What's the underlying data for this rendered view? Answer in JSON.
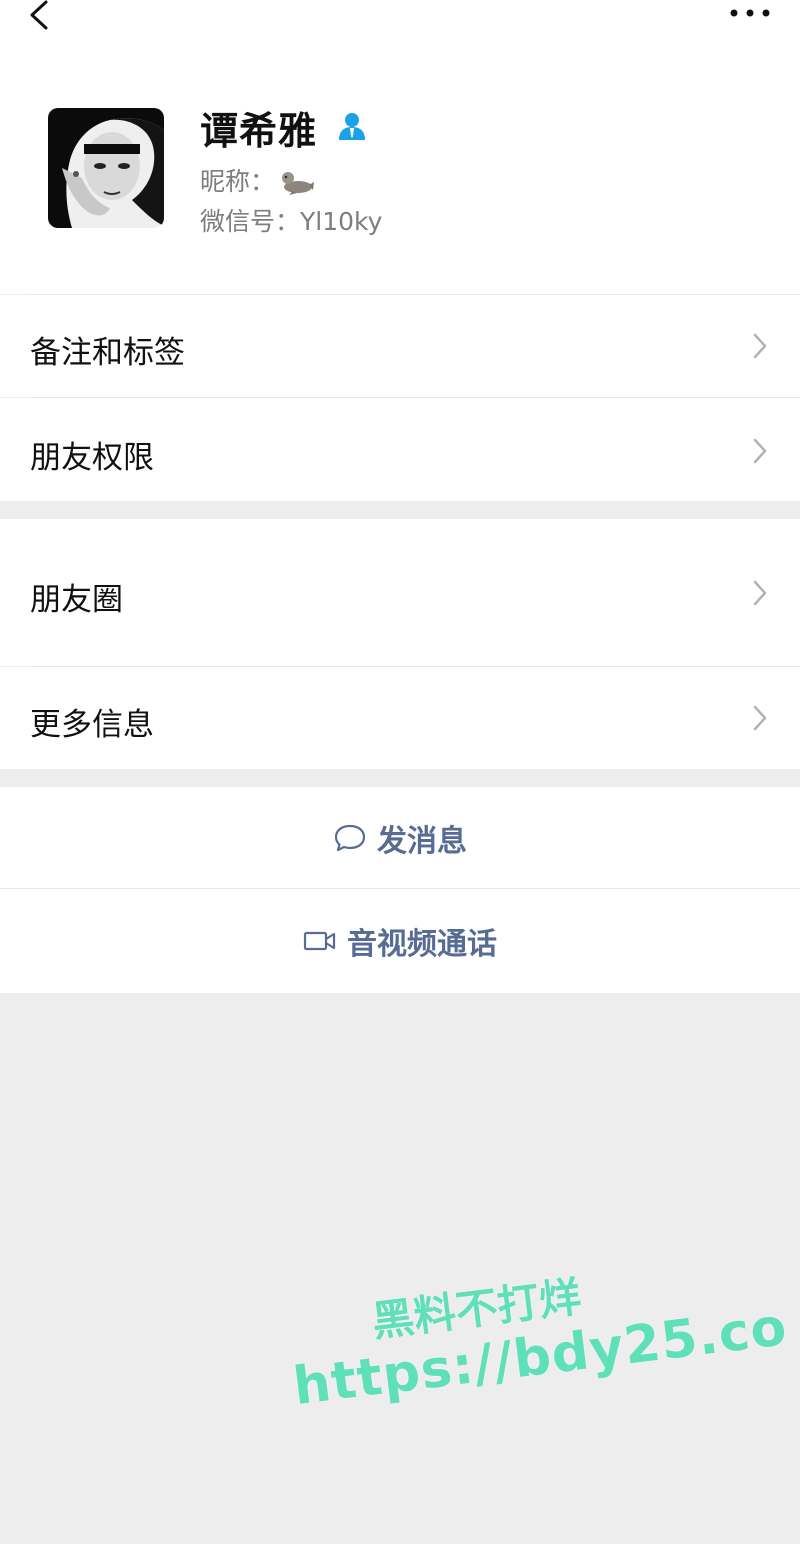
{
  "profile": {
    "name": "谭希雅",
    "nickname_label": "昵称：",
    "wechat_id_label": "微信号：",
    "wechat_id": "Yl10ky"
  },
  "menu": {
    "remark_tags": "备注和标签",
    "friend_permissions": "朋友权限",
    "moments": "朋友圈",
    "more_info": "更多信息"
  },
  "actions": {
    "send_message": "发消息",
    "video_call": "音视频通话"
  },
  "watermark": {
    "line1": "黑料不打烊",
    "line2": "https://bdy25.co"
  },
  "colors": {
    "link_blue": "#576b95",
    "badge_blue": "#1aa2e8",
    "watermark_green": "#5fe0b9",
    "page_bg": "#ededed"
  },
  "icons": [
    "back-icon",
    "more-icon",
    "person-badge-icon",
    "seal-emoji-icon",
    "chevron-right-icon",
    "chat-bubble-icon",
    "video-camera-icon"
  ]
}
